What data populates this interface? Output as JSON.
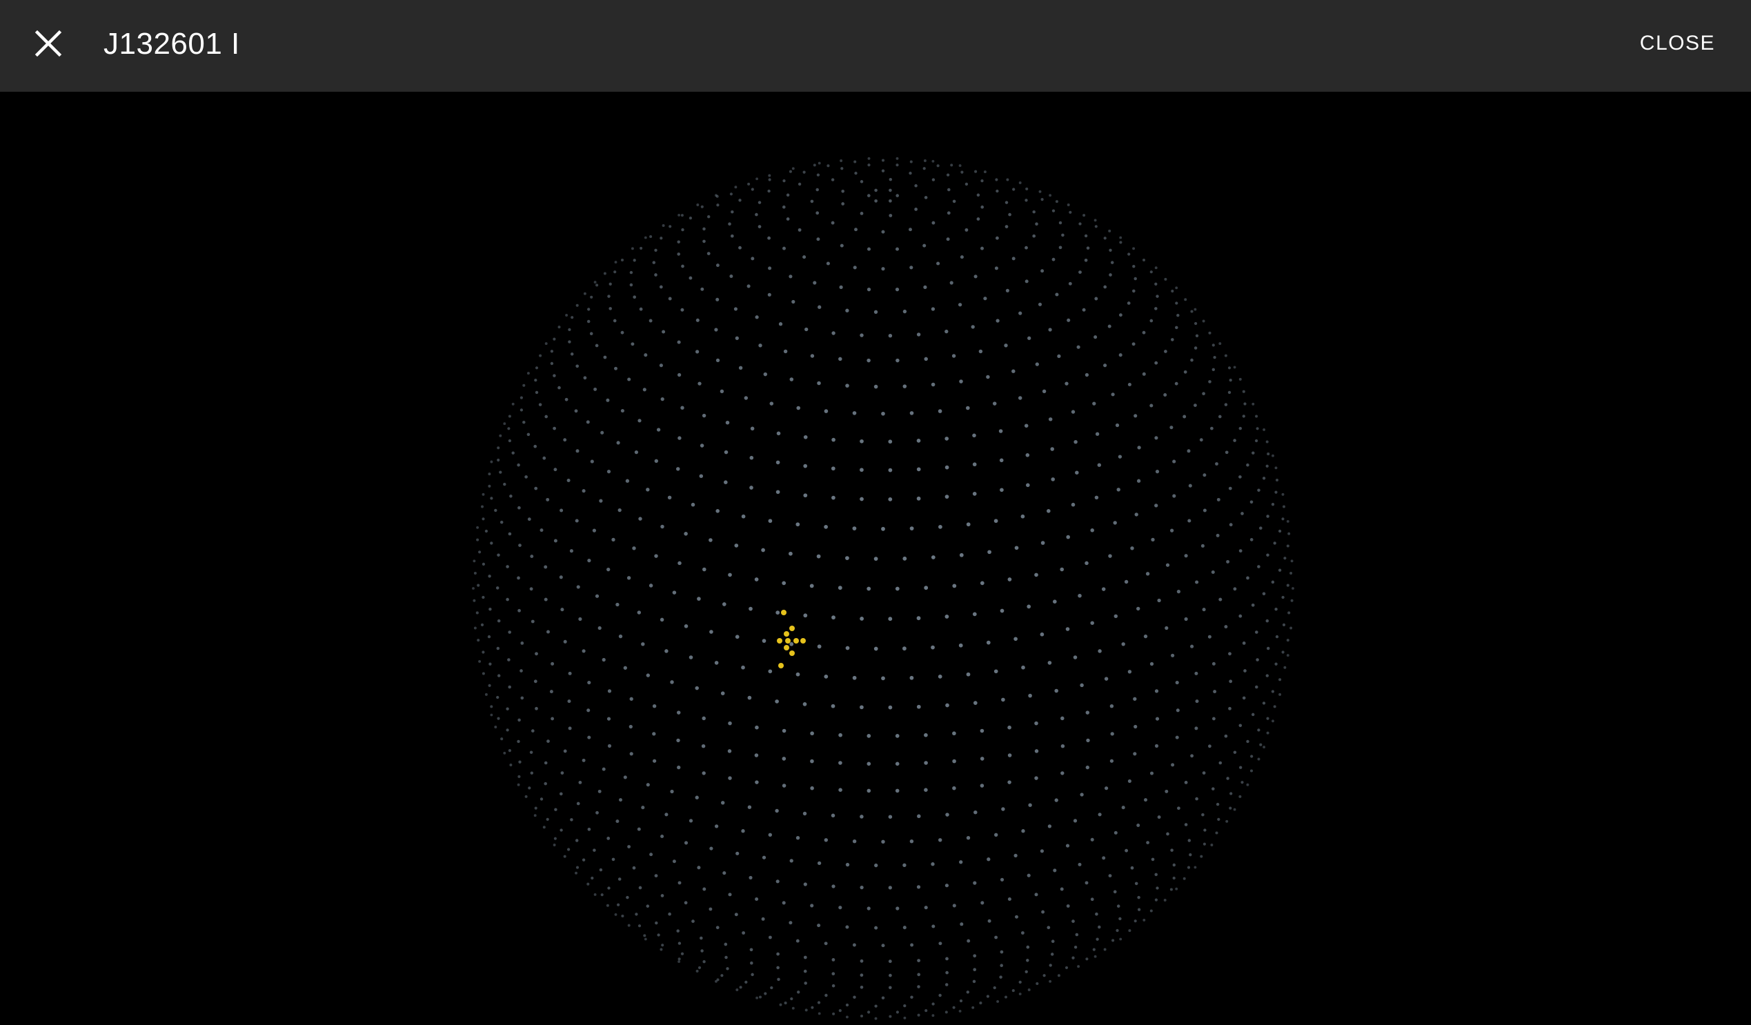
{
  "header": {
    "close_icon": "close-icon",
    "title": "J132601 I",
    "close_label": "CLOSE"
  },
  "viewer": {
    "background": "#000000",
    "sphere_dot_color": "#7e8d9b",
    "highlight_color": "#e6c21c",
    "marker_icon": "arrow-left-icon"
  },
  "colors": {
    "toolbar": "#292929",
    "text": "#ffffff"
  }
}
